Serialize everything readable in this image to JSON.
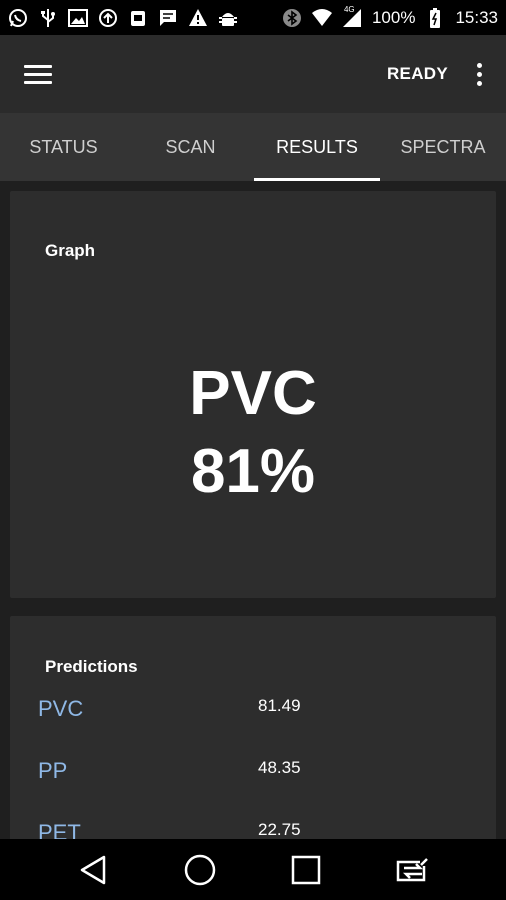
{
  "status_bar": {
    "left_icons": [
      "whatsapp-icon",
      "usb-icon",
      "image-icon",
      "sync-icon",
      "app-icon",
      "message-icon",
      "warning-icon",
      "android-debug-icon"
    ],
    "right_icons": [
      "bluetooth-icon",
      "wifi-icon",
      "signal-icon",
      "battery-icon"
    ],
    "network_type": "4G",
    "battery": "100%",
    "time": "15:33"
  },
  "app_bar": {
    "status": "READY",
    "menu_icon": "hamburger-menu-icon",
    "overflow_icon": "overflow-menu-icon"
  },
  "tabs": [
    {
      "label": "STATUS",
      "active": false
    },
    {
      "label": "SCAN",
      "active": false
    },
    {
      "label": "RESULTS",
      "active": true
    },
    {
      "label": "SPECTRA",
      "active": false
    }
  ],
  "graph": {
    "title": "Graph",
    "material": "PVC",
    "percent": "81%"
  },
  "predictions": {
    "title": "Predictions",
    "items": [
      {
        "name": "PVC",
        "value": "81.49"
      },
      {
        "name": "PP",
        "value": "48.35"
      },
      {
        "name": "PET",
        "value": "22.75"
      }
    ]
  },
  "colors": {
    "accent_link": "#8fb8e6",
    "app_bar": "#2b2b2b",
    "tab_bar": "#343434",
    "card": "#2d2d2d"
  },
  "nav_bar": {
    "buttons": [
      "back-icon",
      "home-icon",
      "recents-icon",
      "switch-app-icon"
    ]
  }
}
